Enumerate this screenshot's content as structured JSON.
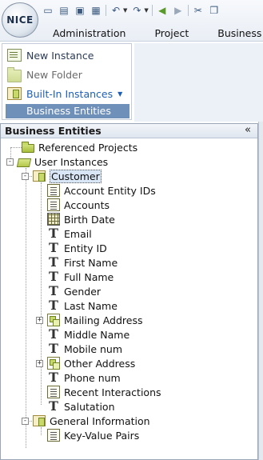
{
  "app": {
    "logo_text": "NICE"
  },
  "menubar": {
    "items": [
      "Administration",
      "Project",
      "Business"
    ]
  },
  "toolbar": {
    "buttons": [
      "new-icon",
      "open-icon",
      "save-icon",
      "save-all-icon",
      "undo-icon",
      "redo-icon",
      "back-icon",
      "forward-icon",
      "cut-icon",
      "copy-icon"
    ]
  },
  "actions": {
    "new_instance": "New Instance",
    "new_folder": "New Folder",
    "built_in_instances": "Built-In Instances",
    "business_entities": "Business Entities"
  },
  "panel": {
    "title": "Business Entities",
    "collapse_glyph": "«"
  },
  "tree": {
    "referenced_projects": "Referenced Projects",
    "user_instances": "User Instances",
    "customer": "Customer",
    "customer_fields": [
      "Account Entity IDs",
      "Accounts",
      "Birth Date",
      "Email",
      "Entity ID",
      "First Name",
      "Full Name",
      "Gender",
      "Last Name",
      "Mailing Address",
      "Middle Name",
      "Mobile num",
      "Other Address",
      "Phone num",
      "Recent Interactions",
      "Salutation"
    ],
    "general_information": "General Information",
    "key_value_pairs": "Key-Value Pairs"
  }
}
